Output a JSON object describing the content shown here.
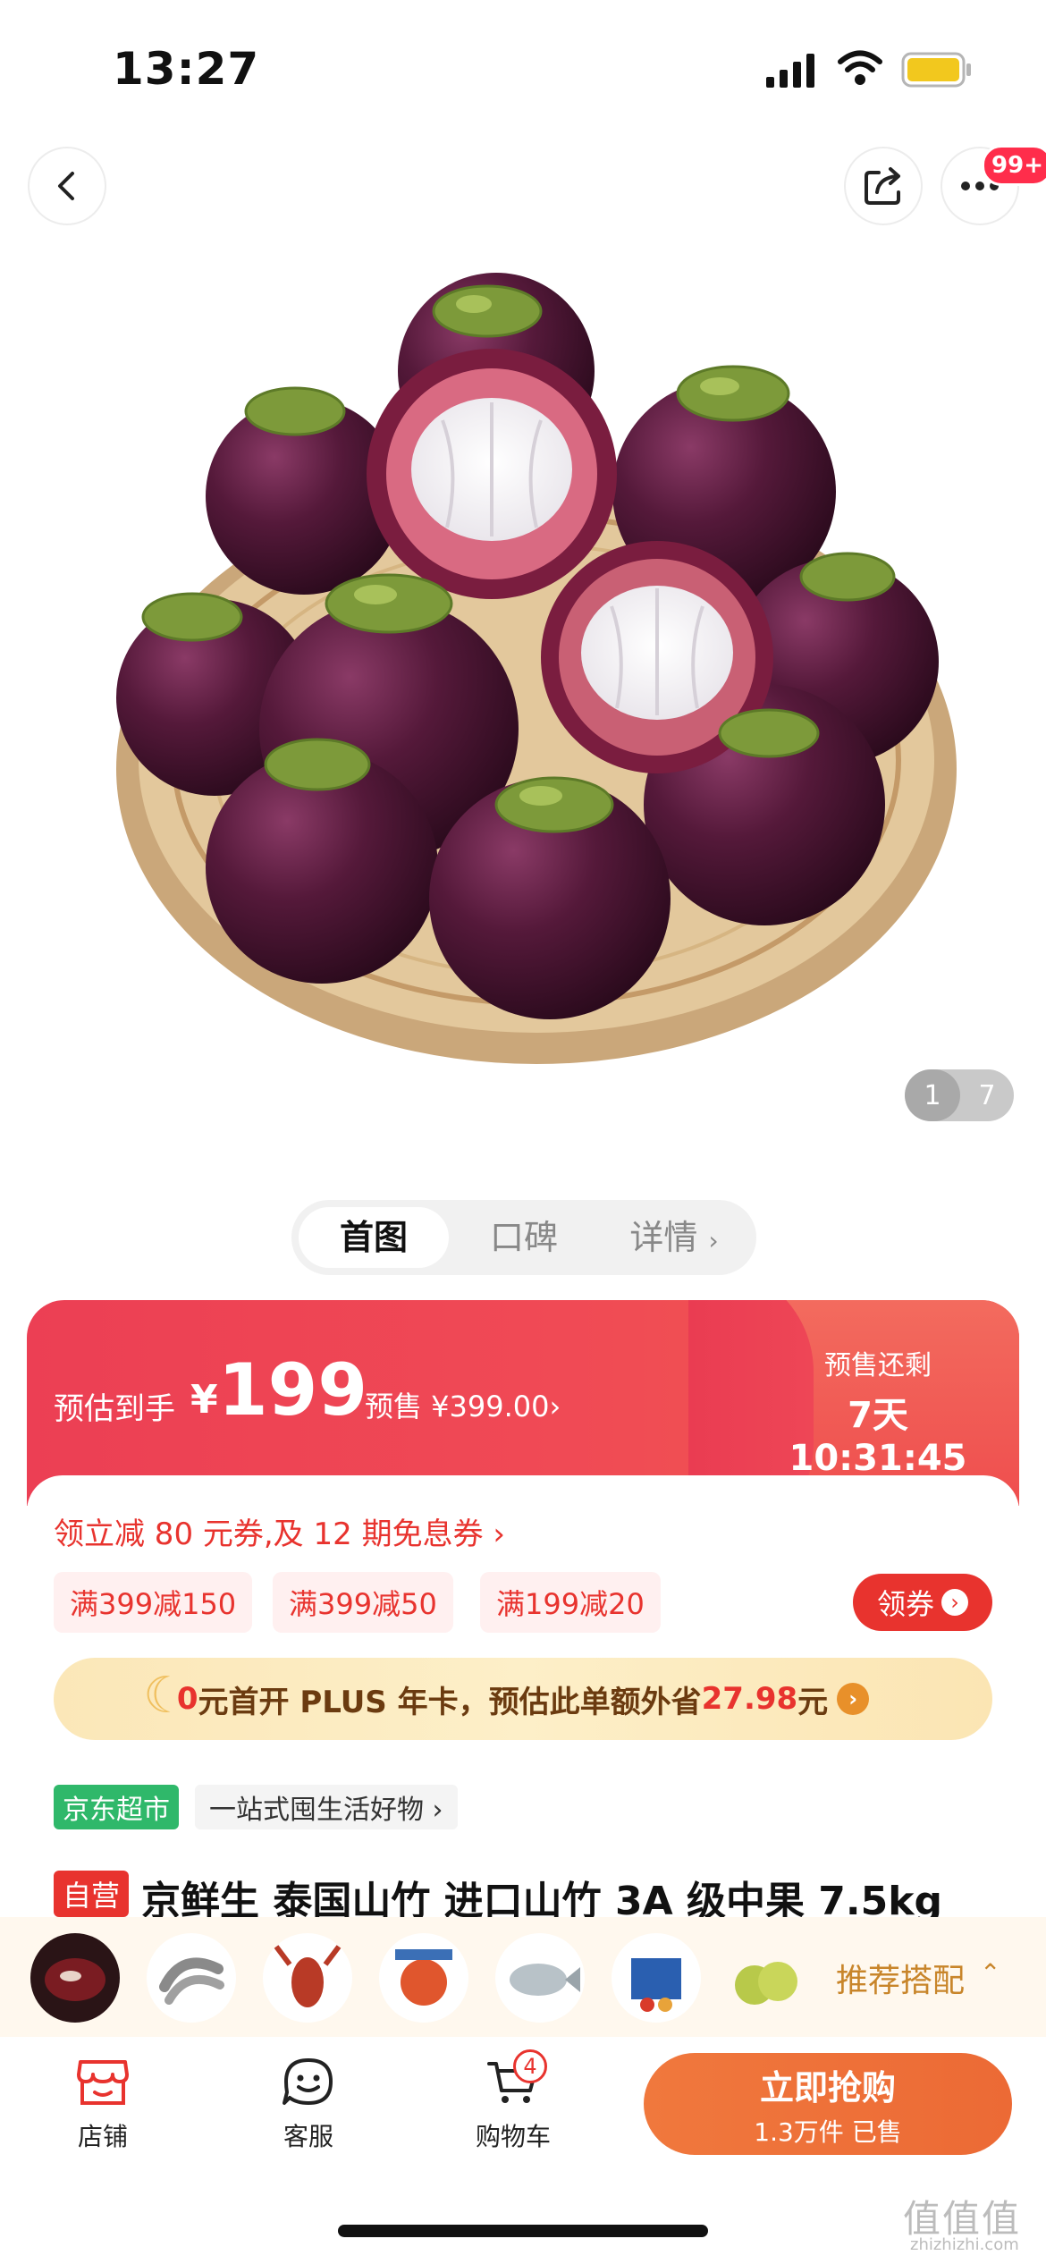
{
  "status_bar": {
    "time": "13:27"
  },
  "header": {
    "back_icon": "chevron-left-icon",
    "share_icon": "share-icon",
    "more_icon": "more-dots-icon",
    "badge": "99+"
  },
  "gallery": {
    "current": "1",
    "total": "7"
  },
  "tabs": [
    {
      "label": "首图",
      "active": true
    },
    {
      "label": "口碑",
      "active": false
    },
    {
      "label": "详情",
      "active": false
    }
  ],
  "price": {
    "label": "预估到手",
    "yen": "¥",
    "value": "199",
    "presale_price": "预售 ¥399.00",
    "presale_arrow": "›",
    "countdown_label": "预售还剩",
    "countdown": "7天 10:31:45"
  },
  "coupons": {
    "link": "领立减 80 元券,及 12 期免息券 ›",
    "chips": [
      "满399减150",
      "满399减50",
      "满199减20"
    ],
    "claim_label": "领券",
    "claim_arrow": "›"
  },
  "plus": {
    "prefix_red": "0",
    "text": "元首开 PLUS 年卡，预估此单额外省",
    "amount": "27.98",
    "suffix": "元",
    "arrow": "›"
  },
  "store": {
    "tag": "京东超市",
    "desc": "一站式囤生活好物 ›"
  },
  "product": {
    "tag": "自营",
    "title": "京鲜生 泰国山竹 进口山竹 3A 级中果 7.5kg"
  },
  "recommend": {
    "label": "推荐搭配",
    "caret": "⌃"
  },
  "bottom_nav": {
    "store_label": "店铺",
    "service_label": "客服",
    "cart_label": "购物车",
    "cart_count": "4",
    "buy_label": "立即抢购",
    "sold_label": "1.3万件 已售"
  },
  "watermark": {
    "main": "值值值",
    "sub": "zhizhizhi.com"
  },
  "colors": {
    "accent_red": "#e8332e",
    "buy_orange": "#ef7038",
    "jd_green": "#2fb86a"
  }
}
